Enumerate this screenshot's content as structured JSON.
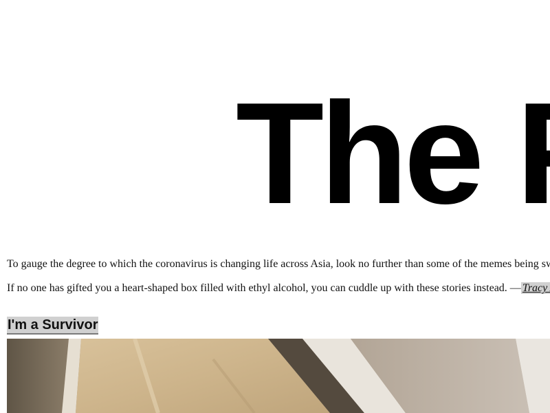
{
  "masthead": {
    "text": "The F"
  },
  "article": {
    "intro_paragraph": "To gauge the degree to which the coronavirus is changing life across Asia, look no further than some of the memes being swapped a",
    "second_paragraph": "If no one has gifted you a heart-shaped box filled with ethyl alcohol, you can cuddle up with these stories instead.  —",
    "byline_link": "Tracy Alloway"
  },
  "section": {
    "heading": "I'm a Survivor"
  },
  "colors": {
    "background": "#ffffff",
    "text": "#111111",
    "link_highlight": "#d0d0d0"
  }
}
